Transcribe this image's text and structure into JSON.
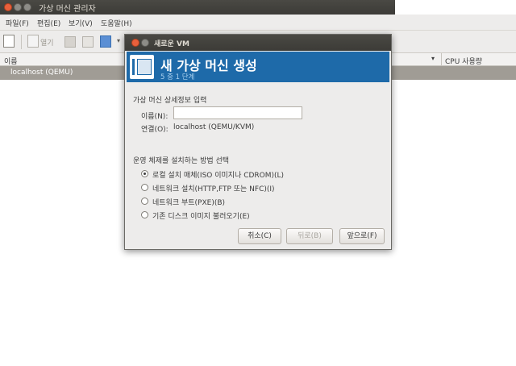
{
  "main_window": {
    "title": "가상 머신 관리자",
    "menu": [
      "파일(F)",
      "편집(E)",
      "보기(V)",
      "도움말(H)"
    ],
    "toolbar_open_label": "열기",
    "column_name": "이름",
    "column_cpu": "CPU 사용량",
    "list_item": "localhost (QEMU)"
  },
  "dialog": {
    "title": "새로운 VM",
    "banner_title": "새 가상 머신 생성",
    "banner_step": "5 중 1 단계",
    "section_details": "가상 머신 상세정보 입력",
    "name_label": "이름(N):",
    "name_value": "",
    "connection_label": "연결(O):",
    "connection_value": "localhost (QEMU/KVM)",
    "section_install": "운영 체제를 설치하는 방법 선택",
    "options": [
      {
        "label": "로컬 설치 매체(ISO 이미지나 CDROM)(L)",
        "selected": true
      },
      {
        "label": "네트워크 설치(HTTP,FTP 또는 NFC)(I)",
        "selected": false
      },
      {
        "label": "네트워크 부트(PXE)(B)",
        "selected": false
      },
      {
        "label": "기존 디스크 이미지 불러오기(E)",
        "selected": false
      }
    ],
    "buttons": {
      "cancel": "취소(C)",
      "back": "뒤로(B)",
      "forward": "앞으로(F)"
    }
  },
  "colors": {
    "banner": "#1e6aa9",
    "titlebar": "#3c3b37",
    "close": "#e8603c",
    "selection": "#a09c95"
  }
}
